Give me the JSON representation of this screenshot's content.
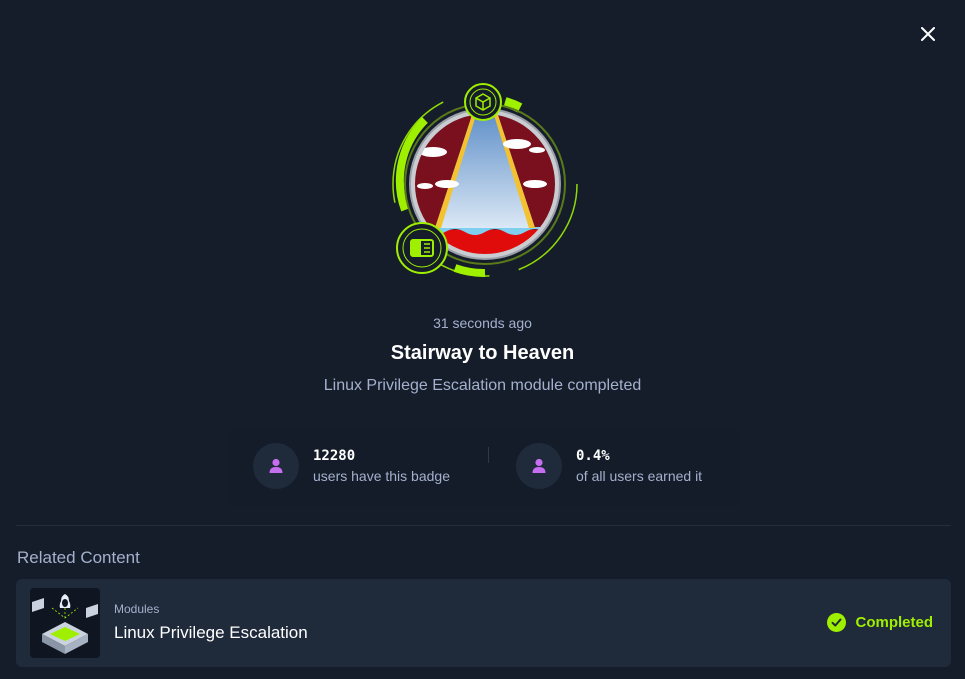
{
  "badge": {
    "time_ago": "31 seconds ago",
    "name": "Stairway to Heaven",
    "description": "Linux Privilege Escalation module completed",
    "icon": "stairway-badge-icon",
    "accent_color": "#9fef00"
  },
  "stats": {
    "users_count": "12280",
    "users_label": "users have this badge",
    "percent": "0.4%",
    "percent_label": "of all users earned it",
    "icon": "user-icon",
    "icon_color": "#c56ff0"
  },
  "related": {
    "heading": "Related Content",
    "items": [
      {
        "category": "Modules",
        "title": "Linux Privilege Escalation",
        "status": "Completed",
        "thumbnail_icon": "linux-module-icon"
      }
    ]
  },
  "close_icon": "close-icon"
}
